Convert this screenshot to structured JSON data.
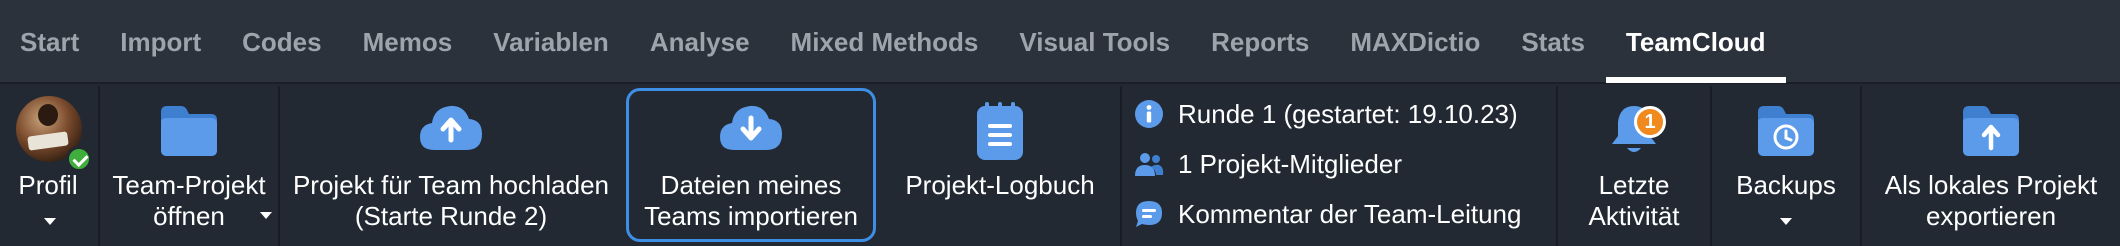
{
  "tabs": [
    {
      "label": "Start"
    },
    {
      "label": "Import"
    },
    {
      "label": "Codes"
    },
    {
      "label": "Memos"
    },
    {
      "label": "Variablen"
    },
    {
      "label": "Analyse"
    },
    {
      "label": "Mixed Methods"
    },
    {
      "label": "Visual Tools"
    },
    {
      "label": "Reports"
    },
    {
      "label": "MAXDictio"
    },
    {
      "label": "Stats"
    },
    {
      "label": "TeamCloud"
    }
  ],
  "active_tab": "TeamCloud",
  "ribbon": {
    "profile": {
      "label": "Profil"
    },
    "team_project": {
      "line1": "Team-Projekt",
      "line2": "öffnen"
    },
    "upload": {
      "line1": "Projekt für Team hochladen",
      "line2": "(Starte Runde 2)"
    },
    "import_files": {
      "line1": "Dateien meines",
      "line2": "Teams importieren"
    },
    "logbook": {
      "label": "Projekt-Logbuch"
    },
    "info": {
      "round": "Runde 1 (gestartet: 19.10.23)",
      "members": "1 Projekt-Mitglieder",
      "comment": "Kommentar der Team-Leitung"
    },
    "activity": {
      "line1": "Letzte",
      "line2": "Aktivität",
      "badge": "1"
    },
    "backups": {
      "label": "Backups"
    },
    "export": {
      "line1": "Als lokales Projekt",
      "line2": "exportieren"
    }
  },
  "colors": {
    "accent_blue": "#4a90e2",
    "highlight_border": "#3f8ee6",
    "badge_orange": "#f08a1f",
    "status_green": "#3fae3c"
  }
}
